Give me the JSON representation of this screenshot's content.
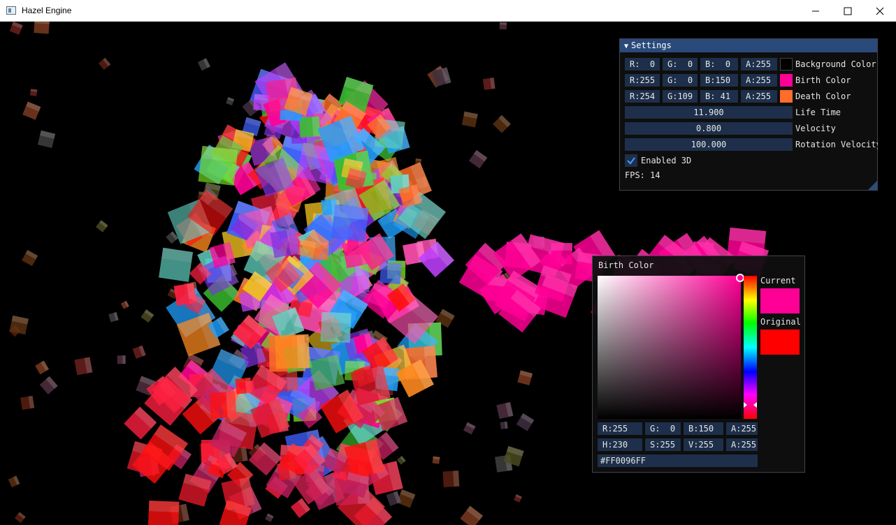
{
  "window": {
    "title": "Hazel Engine",
    "minimize_icon": "minimize-icon",
    "maximize_icon": "maximize-icon",
    "close_icon": "close-icon"
  },
  "settings": {
    "title": "Settings",
    "rows": [
      {
        "r": "R:  0",
        "g": "G:  0",
        "b": "B:  0",
        "a": "A:255",
        "swatch": "#000000",
        "label": "Background Color"
      },
      {
        "r": "R:255",
        "g": "G:  0",
        "b": "B:150",
        "a": "A:255",
        "swatch": "#ff0096",
        "label": "Birth Color"
      },
      {
        "r": "R:254",
        "g": "G:109",
        "b": "B: 41",
        "a": "A:255",
        "swatch": "#fe6d29",
        "label": "Death Color"
      }
    ],
    "sliders": [
      {
        "value": "11.900",
        "label": "Life Time"
      },
      {
        "value": "0.800",
        "label": "Velocity"
      },
      {
        "value": "100.000",
        "label": "Rotation Velocity"
      }
    ],
    "checkbox": {
      "label": "Enabled 3D",
      "checked": true
    },
    "fps": "FPS: 14"
  },
  "picker": {
    "title": "Birth Color",
    "current_label": "Current",
    "original_label": "Original",
    "current_color": "#ff0096",
    "original_color": "#ff0000",
    "rgba": [
      "R:255",
      "G:  0",
      "B:150",
      "A:255"
    ],
    "hsva": [
      "H:230",
      "S:255",
      "V:255",
      "A:255"
    ],
    "hex": "#FF0096FF"
  }
}
